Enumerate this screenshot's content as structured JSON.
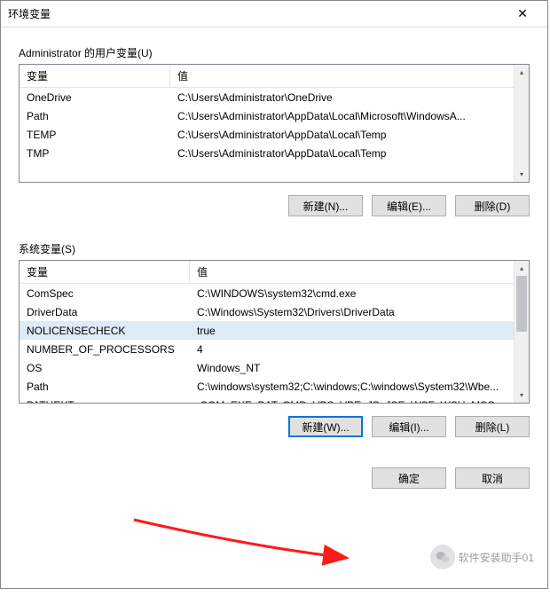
{
  "window": {
    "title": "环境变量",
    "close_glyph": "✕"
  },
  "user_section": {
    "label": "Administrator 的用户变量(U)",
    "headers": {
      "var": "变量",
      "val": "值"
    },
    "rows": [
      {
        "var": "OneDrive",
        "val": "C:\\Users\\Administrator\\OneDrive"
      },
      {
        "var": "Path",
        "val": "C:\\Users\\Administrator\\AppData\\Local\\Microsoft\\WindowsA..."
      },
      {
        "var": "TEMP",
        "val": "C:\\Users\\Administrator\\AppData\\Local\\Temp"
      },
      {
        "var": "TMP",
        "val": "C:\\Users\\Administrator\\AppData\\Local\\Temp"
      }
    ],
    "buttons": {
      "new": "新建(N)...",
      "edit": "编辑(E)...",
      "delete": "删除(D)"
    }
  },
  "system_section": {
    "label": "系统变量(S)",
    "headers": {
      "var": "变量",
      "val": "值"
    },
    "rows": [
      {
        "var": "ComSpec",
        "val": "C:\\WINDOWS\\system32\\cmd.exe"
      },
      {
        "var": "DriverData",
        "val": "C:\\Windows\\System32\\Drivers\\DriverData"
      },
      {
        "var": "NOLICENSECHECK",
        "val": "true",
        "selected": true
      },
      {
        "var": "NUMBER_OF_PROCESSORS",
        "val": "4"
      },
      {
        "var": "OS",
        "val": "Windows_NT"
      },
      {
        "var": "Path",
        "val": "C:\\windows\\system32;C:\\windows;C:\\windows\\System32\\Wbe..."
      },
      {
        "var": "PATHEXT",
        "val": ".COM;.EXE;.BAT;.CMD;.VBS;.VBE;.JS;.JSE;.WSF;.WSH;.MSC"
      }
    ],
    "buttons": {
      "new": "新建(W)...",
      "edit": "编辑(I)...",
      "delete": "删除(L)"
    }
  },
  "dialog_buttons": {
    "ok": "确定",
    "cancel": "取消"
  },
  "overlay": {
    "wechat_text": "软件安装助手01"
  }
}
